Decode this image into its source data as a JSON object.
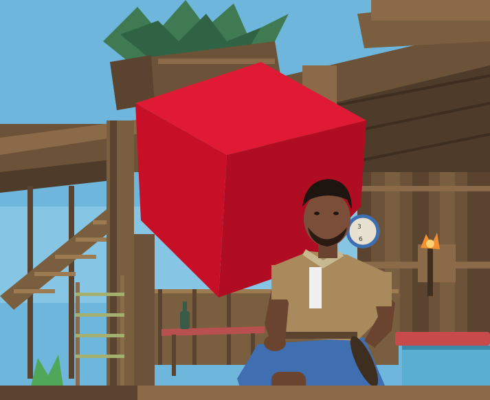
{
  "scene": {
    "type": "3d-game-viewport",
    "objects": [
      {
        "name": "red-cube",
        "color": "#d0112b"
      },
      {
        "name": "character",
        "shirt_color": "#a88a5c",
        "shorts_color": "#3f6fb0"
      },
      {
        "name": "wooden-raft-structure",
        "color": "#6b5238"
      },
      {
        "name": "pineapple-planter",
        "color": "#3f7a52"
      },
      {
        "name": "wall-torch",
        "color": "#f09030"
      },
      {
        "name": "wall-clock",
        "color": "#e8e0d0"
      },
      {
        "name": "storage-crate",
        "color": "#5aaed0"
      },
      {
        "name": "table-with-bottle",
        "color": "#3a5a48"
      }
    ],
    "colors": {
      "sky": "#6fb6dc",
      "wood_dark": "#5a4430",
      "wood_mid": "#7a5e40",
      "wood_light": "#9c7a52",
      "cube_front": "#c80f28",
      "cube_side": "#b00d22",
      "cube_top": "#e01a34"
    }
  }
}
